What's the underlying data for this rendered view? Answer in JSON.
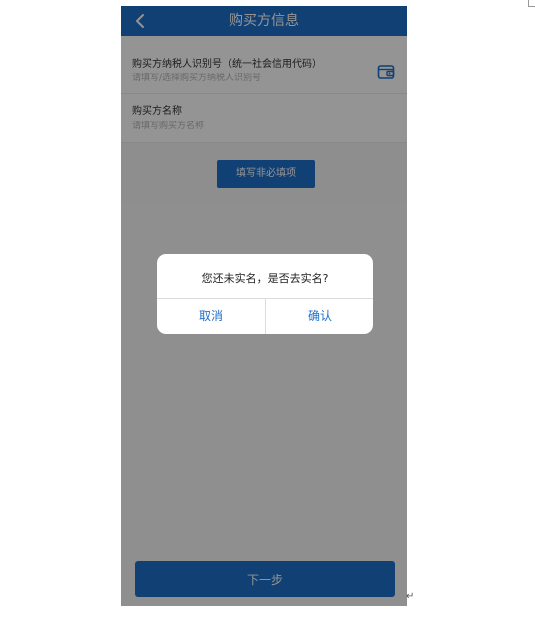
{
  "header": {
    "title": "购买方信息"
  },
  "form": {
    "taxpayer_id": {
      "label": "购买方纳税人识别号（统一社会信用代码）",
      "placeholder": "请填写/选择购买方纳税人识别号",
      "value": ""
    },
    "buyer_name": {
      "label": "购买方名称",
      "placeholder": "请填写购买方名称",
      "value": ""
    }
  },
  "buttons": {
    "optional_fields": "填写非必填项",
    "next": "下一步"
  },
  "dialog": {
    "message": "您还未实名，是否去实名?",
    "cancel": "取消",
    "confirm": "确认"
  },
  "page_marks": {
    "return_symbol": "↵"
  },
  "colors": {
    "primary": "#1e6fc8",
    "overlay": "rgba(0,0,0,0.42)"
  },
  "icons": {
    "back": "chevron-left-icon",
    "wallet": "wallet-icon"
  }
}
